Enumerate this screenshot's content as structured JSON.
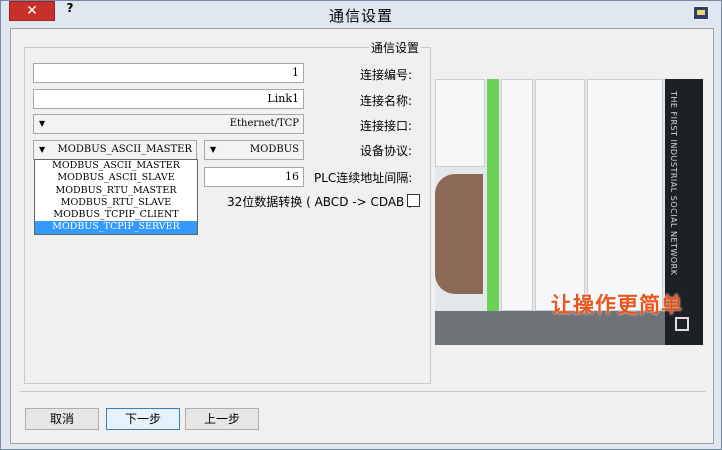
{
  "window": {
    "title": "通信设置",
    "close_glyph": "✕",
    "help_glyph": "?"
  },
  "group": {
    "caption": "通信设置"
  },
  "form": {
    "connection_no": {
      "label": "连接编号:",
      "value": "1"
    },
    "connection_name": {
      "label": "连接名称:",
      "value": "Link1"
    },
    "connection_port": {
      "label": "连接接口:",
      "value": "Ethernet/TCP"
    },
    "device_protocol": {
      "label": "设备协议:",
      "value_left": "MODBUS",
      "value_right": "MODBUS_ASCII_MASTER"
    },
    "plc_interval": {
      "label": "PLC连续地址间隔:",
      "value": "16"
    },
    "bit32_swap": {
      "label": "32位数据转换 ( ABCD -> CDAB )",
      "checked": false
    }
  },
  "protocol_options": [
    "MODBUS_ASCII_MASTER",
    "MODBUS_ASCII_SLAVE",
    "MODBUS_RTU_MASTER",
    "MODBUS_RTU_SLAVE",
    "MODBUS_TCPIP_CLIENT",
    "MODBUS_TCPIP_SERVER"
  ],
  "protocol_selected_index": 5,
  "promo_image": {
    "caption": "让操作更简单",
    "side_text": "THE FIRST INDUSTRIAL SOCIAL NETWORK"
  },
  "buttons": {
    "cancel": "取消",
    "next": "下一步",
    "prev": "上一步"
  },
  "colors": {
    "selected_item": "#3399ff",
    "close_button": "#c7312a",
    "caption_text": "#e8561e",
    "accent_green": "#6ccf57"
  }
}
